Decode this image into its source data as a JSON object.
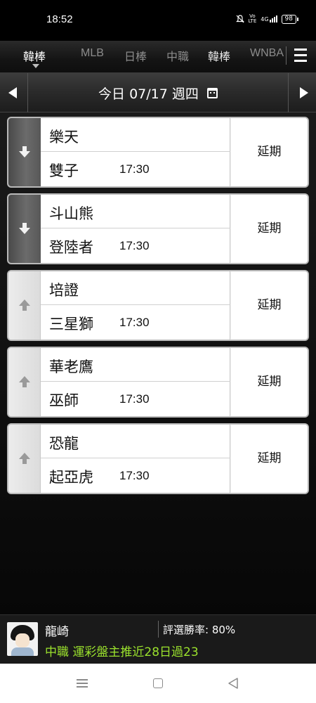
{
  "status_bar": {
    "time": "18:52",
    "icons": [
      "mute-icon",
      "volte-icon",
      "4g-signal-icon",
      "battery-icon"
    ],
    "network": "4G",
    "battery": "98"
  },
  "league_tabs": [
    {
      "label": "韓棒",
      "active": true
    },
    {
      "label": "MLB",
      "active": false
    },
    {
      "label": "日棒",
      "active": false
    },
    {
      "label": "中職",
      "active": false
    },
    {
      "label": "韓棒",
      "active": false
    },
    {
      "label": "WNBA",
      "active": false
    }
  ],
  "date_bar": {
    "date": "今日 07/17 週四",
    "prev_icon": "left-triangle-icon",
    "next_icon": "right-triangle-icon",
    "calendar_icon": "calendar-icon"
  },
  "games": [
    {
      "team_top": "樂天",
      "team_bottom": "雙子",
      "time": "17:30",
      "status": "延期",
      "arrow": "down"
    },
    {
      "team_top": "斗山熊",
      "team_bottom": "登陸者",
      "time": "17:30",
      "status": "延期",
      "arrow": "down"
    },
    {
      "team_top": "培證",
      "team_bottom": "三星獅",
      "time": "17:30",
      "status": "延期",
      "arrow": "up"
    },
    {
      "team_top": "華老鷹",
      "team_bottom": "巫師",
      "time": "17:30",
      "status": "延期",
      "arrow": "up"
    },
    {
      "team_top": "恐龍",
      "team_bottom": "起亞虎",
      "time": "17:30",
      "status": "延期",
      "arrow": "up"
    }
  ],
  "banner": {
    "user": "龍崎",
    "win_rate": "評選勝率: 80%",
    "promo": "中職 運彩盤主推近28日過23",
    "promo_color": "#9be22d"
  },
  "nav": {
    "icons": [
      "recent-apps-icon",
      "home-icon",
      "back-icon"
    ]
  }
}
